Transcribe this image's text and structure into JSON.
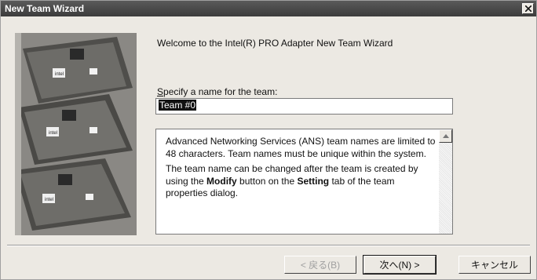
{
  "window": {
    "title": "New Team Wizard",
    "close_label": "×"
  },
  "main": {
    "heading": "Welcome to the Intel(R) PRO Adapter New Team Wizard",
    "name_label_accel": "S",
    "name_label_rest": "pecify a name for the team:",
    "name_value": "Team #0",
    "info_para1": "Advanced Networking Services (ANS) team names are limited to 48 characters. Team names must be unique within the system.",
    "info_para2_a": "The team name can be changed after the team is created by using the ",
    "info_para2_bold1": "Modify",
    "info_para2_b": " button on the ",
    "info_para2_bold2": "Setting",
    "info_para2_c": " tab of the team properties dialog."
  },
  "buttons": {
    "back": "< 戻る(B)",
    "next": "次へ(N) >",
    "cancel": "キャンセル"
  },
  "artwork": {
    "chip_label": "intel"
  }
}
